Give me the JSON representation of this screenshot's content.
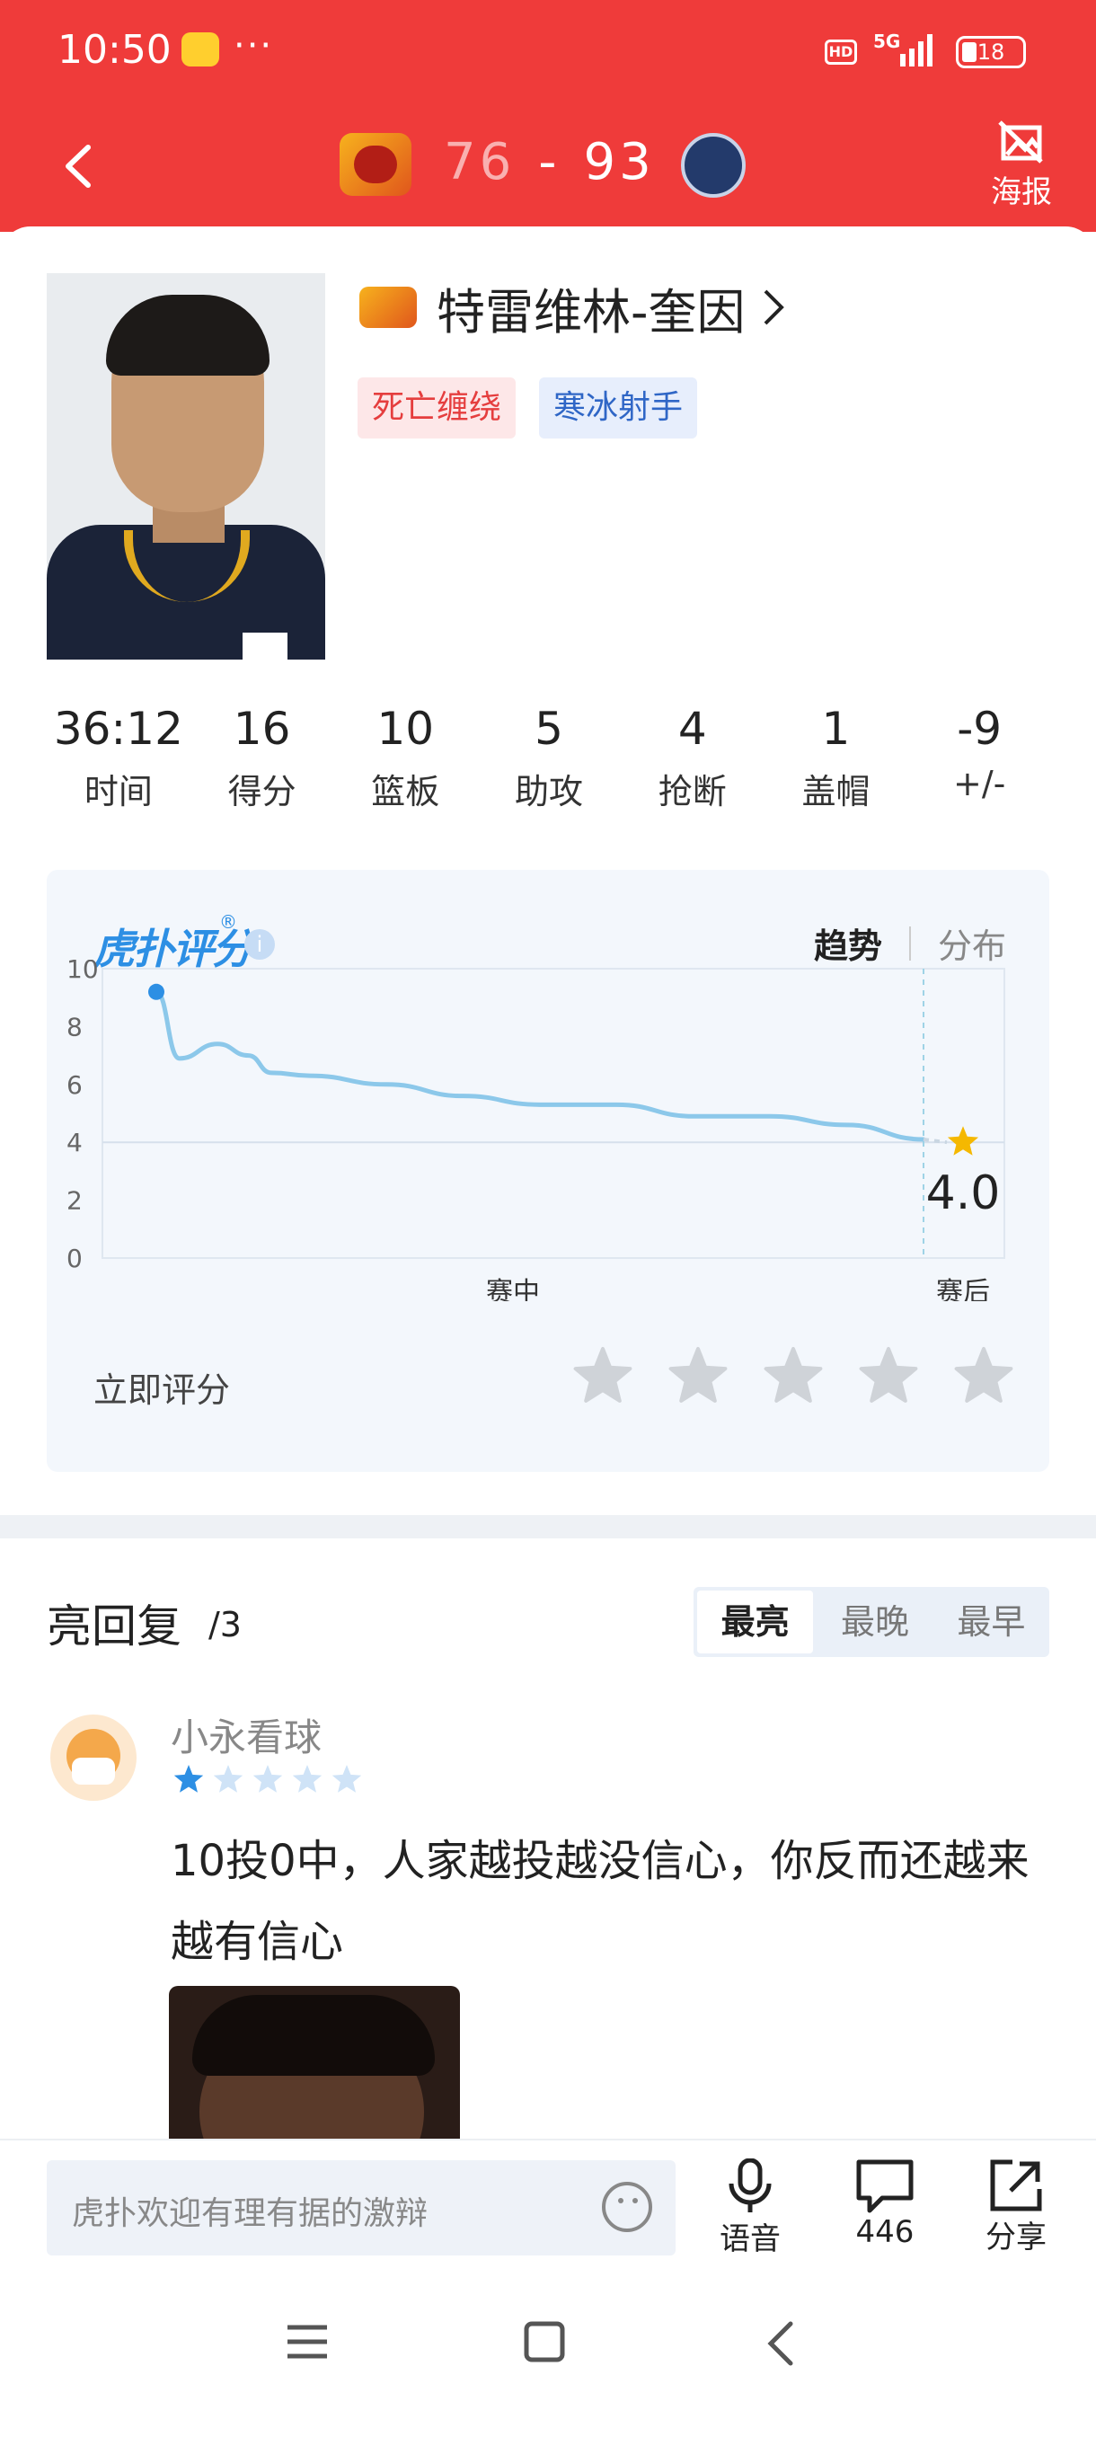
{
  "status_bar": {
    "time": "10:50",
    "more": "···",
    "hd": "HD",
    "network": "5G",
    "battery": "18"
  },
  "header": {
    "home_score": "76",
    "separator": "-",
    "away_score": "93",
    "poster_label": "海报"
  },
  "player": {
    "name": "特雷维林-奎因",
    "tags": [
      "死亡缠绕",
      "寒冰射手"
    ]
  },
  "stats": [
    {
      "value": "36:12",
      "label": "时间"
    },
    {
      "value": "16",
      "label": "得分"
    },
    {
      "value": "10",
      "label": "篮板"
    },
    {
      "value": "5",
      "label": "助攻"
    },
    {
      "value": "4",
      "label": "抢断"
    },
    {
      "value": "1",
      "label": "盖帽"
    },
    {
      "value": "-9",
      "label": "+/-"
    }
  ],
  "rating": {
    "brand": "虎扑评分",
    "brand_mark": "®",
    "info": "i",
    "tab_active": "趋势",
    "tab_inactive": "分布",
    "final_score": "4.0",
    "rate_now_label": "立即评分",
    "star_count": 5
  },
  "chart_data": {
    "type": "line",
    "y_ticks": [
      "10",
      "8",
      "6",
      "4",
      "2",
      "0"
    ],
    "ylim": [
      0,
      10
    ],
    "x_tick_labels": [
      "赛中",
      "赛后"
    ],
    "series": [
      {
        "x": [
          0,
          0.03,
          0.08,
          0.12,
          0.15,
          0.2,
          0.3,
          0.4,
          0.5,
          0.6,
          0.7,
          0.8,
          0.9,
          1.0
        ],
        "values": [
          9.2,
          6.9,
          7.4,
          7.0,
          6.4,
          6.3,
          6.0,
          5.6,
          5.3,
          5.3,
          4.9,
          4.9,
          4.6,
          4.1
        ]
      }
    ],
    "final_value": 4.0,
    "line_color": "#8cc8ea",
    "point_color": "#2d8fe4",
    "marker_color": "#f5b800",
    "grid": true
  },
  "replies": {
    "title": "亮回复",
    "count": "/3",
    "sort_options": [
      "最亮",
      "最晚",
      "最早"
    ],
    "active_sort": "最亮",
    "items": [
      {
        "username": "小永看球",
        "rating": 1,
        "max_rating": 5,
        "text": "10投0中，人家越投越没信心，你反而还越来越有信心"
      }
    ]
  },
  "bottom_bar": {
    "input_placeholder": "虎扑欢迎有理有据的激辩",
    "voice_label": "语音",
    "comment_count": "446",
    "share_label": "分享"
  },
  "colors": {
    "header_red": "#ef3b3a",
    "brand_blue": "#2d8fe4",
    "tag_red": "#e53e3e",
    "tag_blue": "#2f66c6"
  },
  "icons": [
    "back-arrow-icon",
    "poster-icon",
    "chevron-right-icon",
    "info-icon",
    "star-icon",
    "emoji-icon",
    "microphone-icon",
    "comment-icon",
    "share-icon",
    "menu-icon",
    "home-square-icon",
    "back-nav-icon"
  ]
}
